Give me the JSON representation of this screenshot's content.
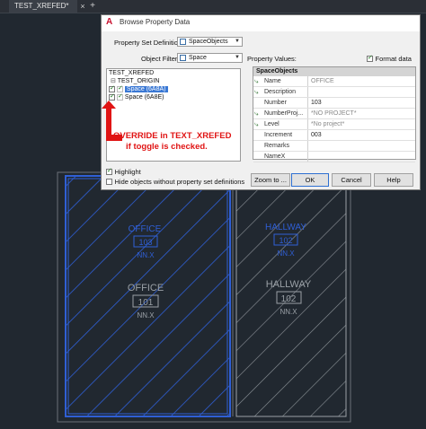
{
  "tabs": {
    "active_tab": "TEST_XREFED*",
    "close": "×",
    "add": "+"
  },
  "dialog": {
    "icon": "autocad-logo-icon",
    "title": "Browse Property Data",
    "property_set_definitions_label": "Property Set Definitions:",
    "property_set_definitions_value": "SpaceObjects",
    "object_filter_label": "Object Filter:",
    "object_filter_value": "Space",
    "property_values_label": "Property Values:",
    "format_data_label": "Format data",
    "format_data_checked": true,
    "tree": {
      "root": "TEST_XREFED",
      "origin": "TEST_ORIGIN",
      "items": [
        {
          "label": "Space (6A8A)",
          "selected": true
        },
        {
          "label": "Space (6A8E)",
          "selected": false
        }
      ]
    },
    "grid": {
      "group": "SpaceObjects",
      "rows": [
        {
          "icon": "link-property-icon",
          "name": "Name",
          "value": "OFFICE",
          "gray": true
        },
        {
          "icon": "link-property-icon",
          "name": "Description",
          "value": "",
          "gray": false
        },
        {
          "icon": "",
          "name": "Number",
          "value": "103",
          "gray": false
        },
        {
          "icon": "link-property-icon",
          "name": "NumberProj...",
          "value": "*NO PROJECT*",
          "gray": true
        },
        {
          "icon": "link-property-icon",
          "name": "Level",
          "value": "*No project*",
          "gray": true
        },
        {
          "icon": "",
          "name": "Increment",
          "value": "003",
          "gray": false
        },
        {
          "icon": "",
          "name": "Remarks",
          "value": "",
          "gray": false
        },
        {
          "icon": "",
          "name": "NameX",
          "value": "",
          "gray": false
        }
      ]
    },
    "highlight_label": "Highlight",
    "highlight_checked": true,
    "hide_label": "Hide objects without property set definitions",
    "hide_checked": false,
    "zoom_button": "Zoom to ...",
    "ok_button": "OK",
    "cancel_button": "Cancel",
    "help_button": "Help"
  },
  "annotation": {
    "line1": "OVERRIDE in TEXT_XREFED",
    "line2": "if toggle is checked."
  },
  "drawing": {
    "left_room_name": "OFFICE",
    "left_room_number": "101",
    "left_room_area": "NN.X",
    "left_room_overlay_name": "OFFICE",
    "left_room_overlay_number": "103",
    "left_room_overlay_area": "NN.X",
    "right_room_name": "HALLWAY",
    "right_room_number": "102",
    "right_room_area": "NN.X",
    "right_room_overlay_name": "HALLWAY",
    "right_room_overlay_number": "102",
    "right_room_overlay_area": "NN.X",
    "colors": {
      "selected": "#2f5fd6",
      "unselected": "#9aa0a6",
      "annotation": "#e01414"
    }
  }
}
